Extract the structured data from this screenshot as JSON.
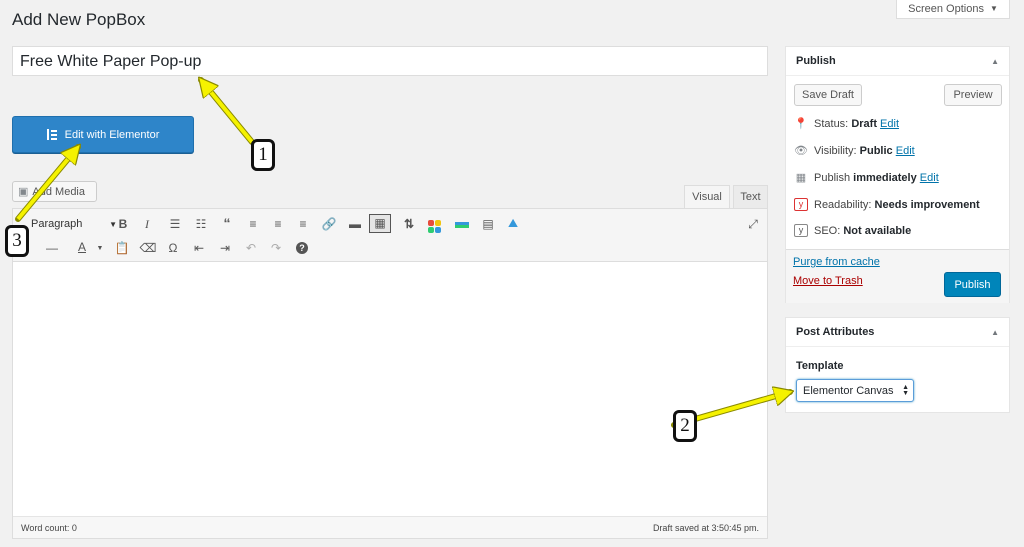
{
  "header": {
    "page_title": "Add New PopBox",
    "screen_options": "Screen Options"
  },
  "post_title": "Free White Paper Pop-up",
  "elementor_button": "Edit with Elementor",
  "editor": {
    "add_media": "Add Media",
    "tabs": {
      "visual": "Visual",
      "text": "Text"
    },
    "format": "Paragraph",
    "word_count": "Word count: 0",
    "draft_saved": "Draft saved at 3:50:45 pm."
  },
  "publish": {
    "title": "Publish",
    "save_draft": "Save Draft",
    "preview": "Preview",
    "status_label": "Status:",
    "status_value": "Draft",
    "visibility_label": "Visibility:",
    "visibility_value": "Public",
    "publish_label": "Publish",
    "publish_value": "immediately",
    "edit": "Edit",
    "readability_label": "Readability:",
    "readability_value": "Needs improvement",
    "seo_label": "SEO:",
    "seo_value": "Not available",
    "purge_cache": "Purge from cache",
    "move_to_trash": "Move to Trash",
    "publish_button": "Publish"
  },
  "post_attributes": {
    "title": "Post Attributes",
    "template_label": "Template",
    "template_value": "Elementor Canvas"
  },
  "annotations": {
    "callout_1": "1",
    "callout_2": "2",
    "callout_3": "3",
    "arrow_color": "#f5f200"
  },
  "colors": {
    "elementor_blue": "#2e85c9",
    "wp_primary": "#0085ba",
    "link": "#0073aa",
    "trash": "#a00000",
    "yoast_red": "#dc3232"
  }
}
